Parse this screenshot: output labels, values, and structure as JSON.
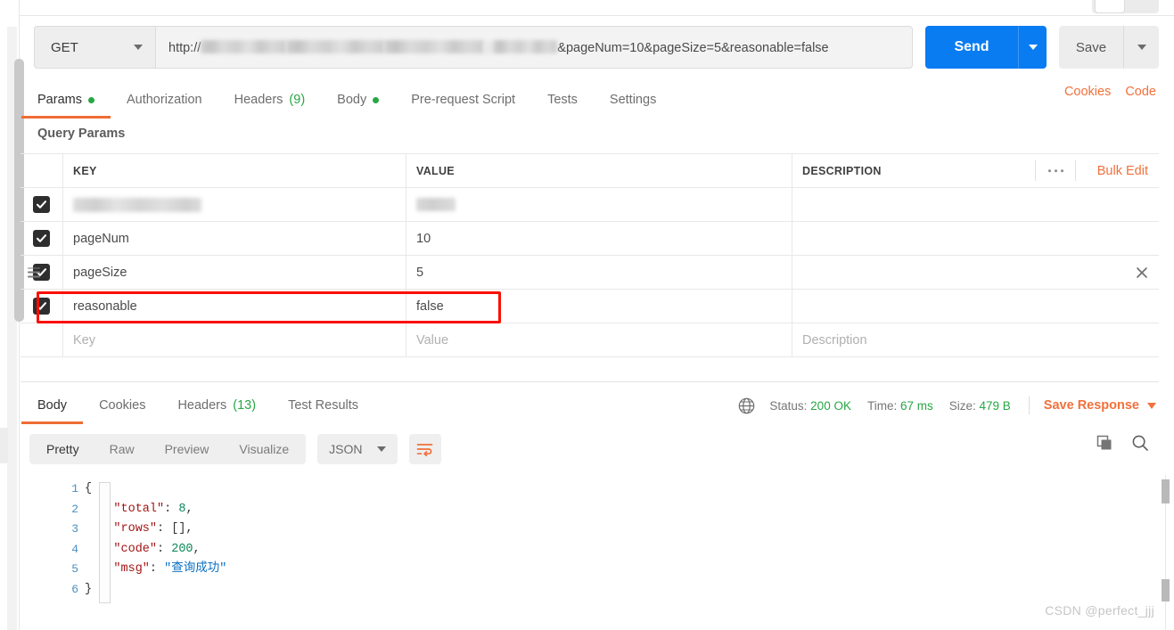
{
  "request": {
    "method": "GET",
    "url_prefix": "http://",
    "url_query": "&pageNum=10&pageSize=5&reasonable=false",
    "send_label": "Send",
    "save_label": "Save"
  },
  "request_tabs": [
    {
      "label": "Params",
      "dot": true,
      "active": true
    },
    {
      "label": "Authorization",
      "dot": false,
      "active": false
    },
    {
      "label": "Headers",
      "count": "(9)",
      "dot": false,
      "active": false
    },
    {
      "label": "Body",
      "dot": true,
      "active": false
    },
    {
      "label": "Pre-request Script",
      "dot": false,
      "active": false
    },
    {
      "label": "Tests",
      "dot": false,
      "active": false
    },
    {
      "label": "Settings",
      "dot": false,
      "active": false
    }
  ],
  "tab_links": {
    "cookies": "Cookies",
    "code": "Code"
  },
  "params": {
    "section_title": "Query Params",
    "headers": {
      "key": "KEY",
      "value": "VALUE",
      "description": "DESCRIPTION"
    },
    "bulk_edit": "Bulk Edit",
    "rows": [
      {
        "checked": true,
        "key": "",
        "value": "",
        "blurred": true,
        "description": ""
      },
      {
        "checked": true,
        "key": "pageNum",
        "value": "10",
        "blurred": false,
        "description": ""
      },
      {
        "checked": true,
        "key": "pageSize",
        "value": "5",
        "blurred": false,
        "description": ""
      },
      {
        "checked": true,
        "key": "reasonable",
        "value": "false",
        "blurred": false,
        "description": ""
      }
    ],
    "placeholder_row": {
      "key": "Key",
      "value": "Value",
      "description": "Description"
    }
  },
  "response_tabs": [
    {
      "label": "Body",
      "active": true
    },
    {
      "label": "Cookies",
      "active": false
    },
    {
      "label": "Headers",
      "count": "(13)",
      "active": false
    },
    {
      "label": "Test Results",
      "active": false
    }
  ],
  "status_bar": {
    "status_label": "Status:",
    "status_value": "200 OK",
    "time_label": "Time:",
    "time_value": "67 ms",
    "size_label": "Size:",
    "size_value": "479 B",
    "save_response": "Save Response"
  },
  "body_toolbar": {
    "views": [
      {
        "label": "Pretty",
        "active": true
      },
      {
        "label": "Raw",
        "active": false
      },
      {
        "label": "Preview",
        "active": false
      },
      {
        "label": "Visualize",
        "active": false
      }
    ],
    "format": "JSON"
  },
  "code": {
    "line_numbers": [
      "1",
      "2",
      "3",
      "4",
      "5",
      "6"
    ],
    "lines": [
      "{",
      "    \"total\": 8,",
      "    \"rows\": [],",
      "    \"code\": 200,",
      "    \"msg\": \"查询成功\"",
      "}"
    ],
    "json": {
      "total": "8",
      "rows": "[]",
      "code": "200",
      "msg": "查询成功"
    }
  },
  "watermark": "CSDN @perfect_jjj",
  "colors": {
    "accent_orange": "#f1713c",
    "send_blue": "#0a7cf2",
    "green": "#27a745",
    "highlight_red": "#fa0f00"
  }
}
